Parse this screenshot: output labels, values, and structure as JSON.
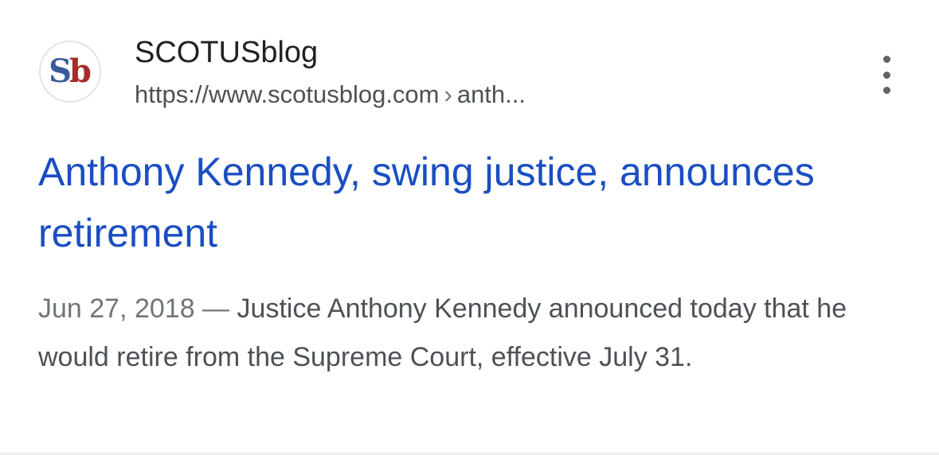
{
  "source": {
    "favicon_text_s": "S",
    "favicon_text_b": "b",
    "favicon_icon": "scotusblog-logo-icon",
    "name": "SCOTUSblog",
    "url_domain": "https://www.scotusblog.com",
    "url_separator": "›",
    "url_path": "anth..."
  },
  "menu": {
    "icon": "more-vertical-icon"
  },
  "result": {
    "title": "Anthony Kennedy, swing justice, announces retirement",
    "date": "Jun 27, 2018",
    "date_separator": "—",
    "snippet": "Justice Anthony Kennedy announced today that he would retire from the Supreme Court, effective July 31."
  },
  "colors": {
    "title_link": "#1a4ec2",
    "site_name": "#202124",
    "snippet_text": "#4d5156",
    "date_text": "#70757a",
    "logo_s": "#3b5a9a",
    "logo_b": "#a42d2a"
  }
}
